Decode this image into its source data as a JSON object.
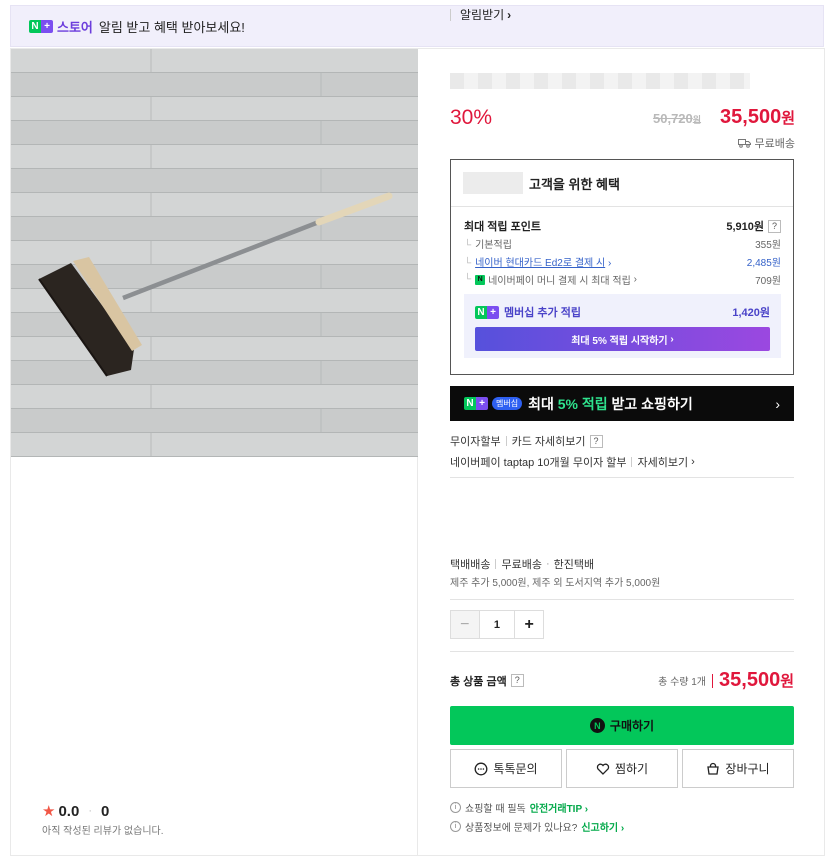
{
  "topbar": {
    "store_label": "스토어",
    "message": "알림 받고 혜택 받아보세요!",
    "notify_label": "알림받기"
  },
  "product": {
    "discount": "30%",
    "original_price": "50,720",
    "original_unit": "원",
    "price": "35,500",
    "price_unit": "원",
    "free_shipping": "무료배송"
  },
  "benefit": {
    "title": "고객을 위한 혜택",
    "max_points_label": "최대 적립 포인트",
    "max_points_value": "5,910원",
    "rows": [
      {
        "label": "기본적립",
        "value": "355원"
      },
      {
        "label": "네이버 현대카드 Ed2로 결제 시",
        "value": "2,485원"
      },
      {
        "label": "네이버페이 머니 결제 시 최대 적립",
        "value": "709원"
      }
    ],
    "membership_label": "멤버십 추가 적립",
    "membership_value": "1,420원",
    "membership_button": "최대 5% 적립 시작하기"
  },
  "banner": {
    "badge": "멤버십",
    "text_prefix": "최대 ",
    "text_highlight": "5% 적립",
    "text_suffix": " 받고 쇼핑하기"
  },
  "card": {
    "installment": "무이자할부",
    "card_detail": "카드 자세히보기",
    "taptap": "네이버페이 taptap 10개월 무이자 할부",
    "taptap_detail": "자세히보기"
  },
  "shipping": {
    "method": "택배배송",
    "fee": "무료배송",
    "carrier": "한진택배",
    "extra": "제주 추가 5,000원, 제주 외 도서지역 추가 5,000원"
  },
  "quantity": {
    "value": "1"
  },
  "total": {
    "label": "총 상품 금액",
    "count": "총 수량 1개",
    "price": "35,500",
    "unit": "원"
  },
  "actions": {
    "buy": "구매하기",
    "talk": "톡톡문의",
    "wish": "찜하기",
    "cart": "장바구니"
  },
  "tips": [
    {
      "text": "쇼핑할 때 필독",
      "link": "안전거래TIP"
    },
    {
      "text": "상품정보에 문제가 있나요?",
      "link": "신고하기"
    }
  ],
  "review": {
    "score": "0.0",
    "count": "0",
    "empty_text": "아직 작성된 리뷰가 없습니다."
  },
  "colors": {
    "price_red": "#e0173c",
    "naver_green": "#03c75a",
    "membership_purple": "#7b4ef0"
  }
}
